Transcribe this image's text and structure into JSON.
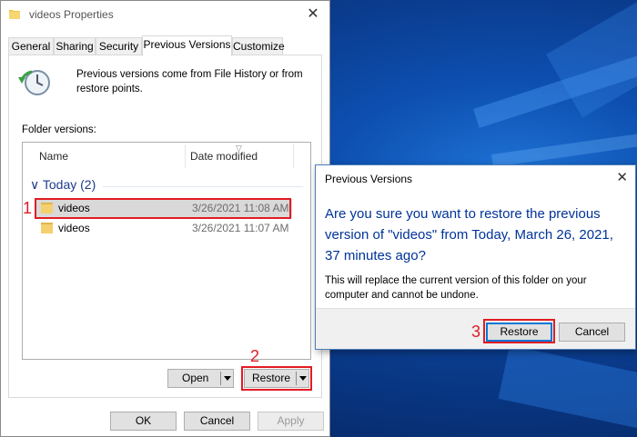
{
  "window": {
    "title": "videos Properties",
    "close_glyph": "✕",
    "tabs": [
      {
        "label": "General"
      },
      {
        "label": "Sharing"
      },
      {
        "label": "Security"
      },
      {
        "label": "Previous Versions"
      },
      {
        "label": "Customize"
      }
    ],
    "active_tab": "Previous Versions",
    "intro_text": "Previous versions come from File History or from restore points.",
    "folder_versions_label": "Folder versions:",
    "list": {
      "columns": [
        "Name",
        "Date modified"
      ],
      "group": "Today (2)",
      "group_chevron": "∨",
      "rows": [
        {
          "name": "videos",
          "date": "3/26/2021 11:08 AM",
          "selected": true
        },
        {
          "name": "videos",
          "date": "3/26/2021 11:07 AM",
          "selected": false
        }
      ]
    },
    "buttons": {
      "open": "Open",
      "restore": "Restore",
      "ok": "OK",
      "cancel": "Cancel",
      "apply": "Apply"
    }
  },
  "dialog": {
    "title": "Previous Versions",
    "close_glyph": "✕",
    "question": "Are you sure you want to restore the previous version of \"videos\" from Today, March 26, 2021, 37 minutes ago?",
    "detail": "This will replace the current version of this folder on your computer and cannot be undone.",
    "buttons": {
      "restore": "Restore",
      "cancel": "Cancel"
    }
  },
  "annotations": {
    "step1": "1",
    "step2": "2",
    "step3": "3",
    "color": "#e31b23"
  },
  "icons": [
    "folder-icon",
    "history-clock-icon",
    "close-icon",
    "dropdown-arrow-icon",
    "chevron-down-icon"
  ]
}
